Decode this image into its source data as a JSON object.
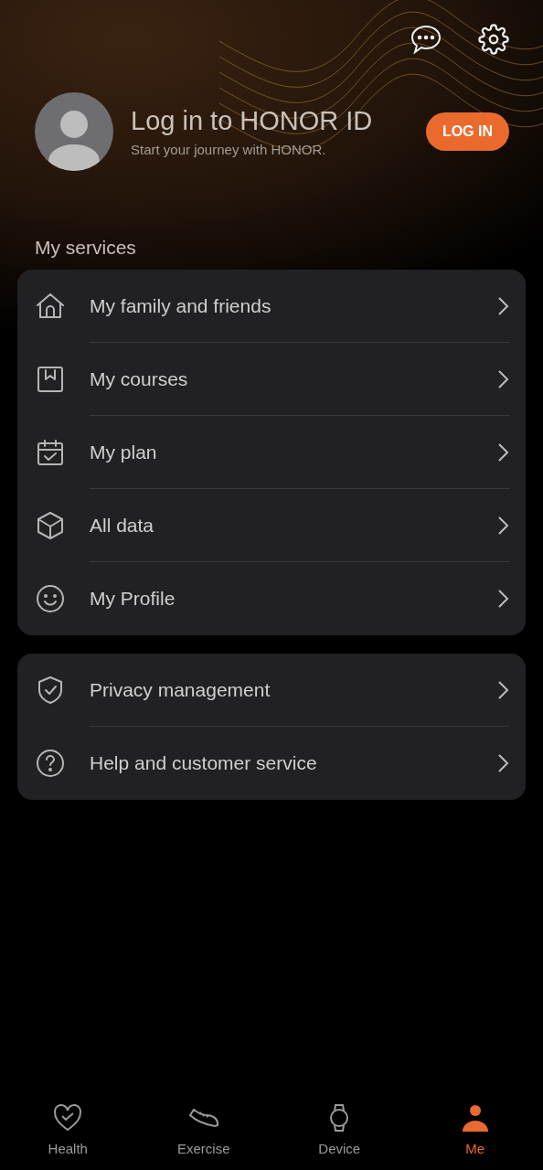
{
  "profile": {
    "title": "Log in to HONOR ID",
    "subtitle": "Start your journey with HONOR.",
    "login_button": "LOG IN"
  },
  "services_heading": "My services",
  "groups": [
    {
      "items": [
        {
          "kind": "home",
          "label": "My family and friends"
        },
        {
          "kind": "courses",
          "label": "My courses"
        },
        {
          "kind": "calendar",
          "label": "My plan"
        },
        {
          "kind": "cube",
          "label": "All data"
        },
        {
          "kind": "smile",
          "label": "My Profile"
        }
      ]
    },
    {
      "items": [
        {
          "kind": "shield",
          "label": "Privacy management"
        },
        {
          "kind": "help",
          "label": "Help and customer service"
        }
      ]
    }
  ],
  "tabs": [
    {
      "kind": "heart",
      "label": "Health",
      "selected": false
    },
    {
      "kind": "shoe",
      "label": "Exercise",
      "selected": false
    },
    {
      "kind": "watch",
      "label": "Device",
      "selected": false
    },
    {
      "kind": "person",
      "label": "Me",
      "selected": true
    }
  ]
}
